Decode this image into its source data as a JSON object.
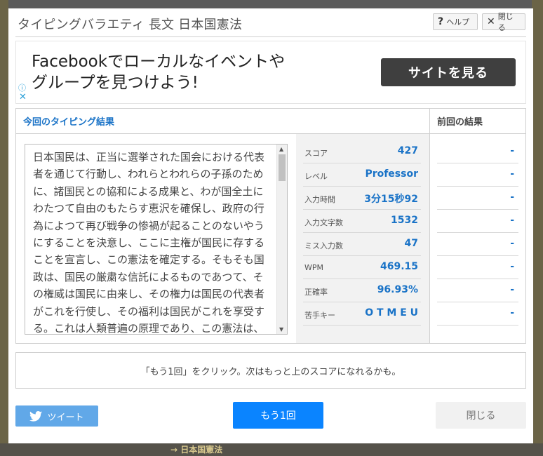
{
  "background": {
    "bottom_text": "→ 日本国憲法"
  },
  "header": {
    "title": "タイピングバラエティ 長文 日本国憲法",
    "help_label": "ヘルプ",
    "close_label": "閉じる"
  },
  "ad": {
    "line1": "Facebookでローカルなイベントや",
    "line2": "グループを見つけよう!",
    "button_label": "サイトを見る",
    "info_icon": "ⓘ",
    "close_icon": "✕"
  },
  "results": {
    "heading": "今回のタイピング結果",
    "previous_heading": "前回の結果",
    "text": "日本国民は、正当に選挙された国会における代表\n者を通じて行動し、われらとわれらの子孫のため\nに、諸国民との協和による成果と、わが国全土に\nわたつて自由のもたらす恵沢を確保し、政府の行\n為によつて再び戦争の惨禍が起ることのないやう\nにすることを決意し、ここに主権が国民に存する\nことを宣言し、この憲法を確定する。そもそも国\n政は、国民の厳粛な信託によるものであつて、そ\nの権威は国民に由来し、その権力は国民の代表者\nがこれを行使し、その福利は国民がこれを享受す\nる。これは人類普遍の原理であり、この憲法は、\nかかる原理に基くものである。われらは、これに",
    "stats": [
      {
        "label": "スコア",
        "value": "427",
        "previous": "-"
      },
      {
        "label": "レベル",
        "value": "Professor",
        "previous": "-"
      },
      {
        "label": "入力時間",
        "value": "3分15秒92",
        "previous": "-"
      },
      {
        "label": "入力文字数",
        "value": "1532",
        "previous": "-"
      },
      {
        "label": "ミス入力数",
        "value": "47",
        "previous": "-"
      },
      {
        "label": "WPM",
        "value": "469.15",
        "previous": "-"
      },
      {
        "label": "正確率",
        "value": "96.93%",
        "previous": "-"
      },
      {
        "label": "苦手キー",
        "value": "O T M E U",
        "previous": "-"
      }
    ]
  },
  "message": "「もう1回」をクリック。次はもっと上のスコアになれるかも。",
  "footer": {
    "tweet_label": "ツイート",
    "retry_label": "もう1回",
    "close_label": "閉じる"
  },
  "colors": {
    "accent": "#1a73c7",
    "retry_button": "#0a84ff",
    "tweet_button": "#61a8e8"
  }
}
